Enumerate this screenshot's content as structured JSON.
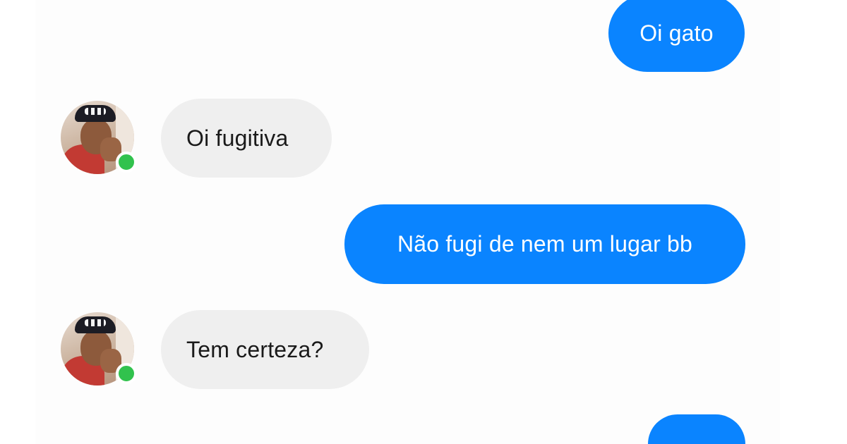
{
  "conversation": {
    "messages": [
      {
        "direction": "outgoing",
        "text": "Oi gato"
      },
      {
        "direction": "incoming",
        "text": "Oi fugitiva"
      },
      {
        "direction": "outgoing",
        "text": "Não fugi de nem um lugar bb"
      },
      {
        "direction": "incoming",
        "text": "Tem certeza?"
      },
      {
        "direction": "outgoing",
        "text": ""
      }
    ]
  },
  "contact": {
    "status": "online",
    "status_color": "#31c24d"
  },
  "colors": {
    "outgoing_bubble": "#0a84ff",
    "incoming_bubble": "#efefef"
  }
}
